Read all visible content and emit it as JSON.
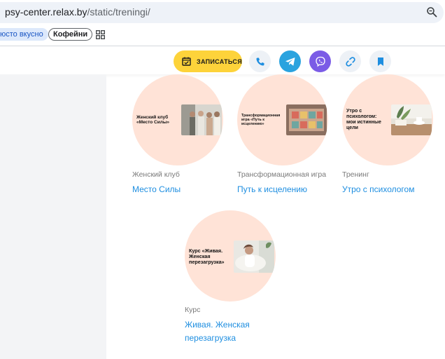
{
  "browser": {
    "address_host": "psy-center.relax.by",
    "address_path": "/static/treningi/",
    "bookmarks": [
      {
        "label": "юсто вкусно"
      },
      {
        "label": "Кофейни"
      }
    ]
  },
  "actions": {
    "book_label": "ЗАПИСАТЬСЯ"
  },
  "cards": [
    {
      "banner_text": "Женский клуб «Место Силы»",
      "category": "Женский клуб",
      "title": "Место Силы"
    },
    {
      "banner_text": "Трансформационная игра «Путь к исцелению»",
      "category": "Трансформационная игра",
      "title": "Путь к исцелению"
    },
    {
      "banner_text": "Утро с психологом: мои истинные цели",
      "category": "Тренинг",
      "title": "Утро с психологом"
    },
    {
      "banner_text": "Курс «Живая. Женская перезагрузка»",
      "category": "Курс",
      "title_line1": "Живая. Женская",
      "title_line2": "перезагрузка"
    }
  ],
  "colors": {
    "accent_yellow": "#fdd33a",
    "telegram": "#2aa3df",
    "viber": "#7b5ce6",
    "link_blue": "#1e8ee0",
    "circle_bg": "#ffe3d7"
  }
}
